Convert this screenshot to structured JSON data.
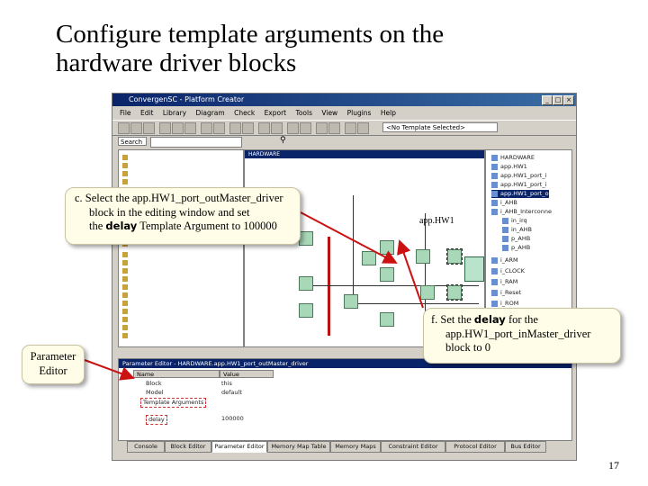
{
  "slide": {
    "title_line1": "Configure template arguments on the",
    "title_line2": "hardware driver blocks",
    "page_number": "17"
  },
  "app": {
    "title": "ConvergenSC - Platform Creator",
    "menu": [
      "File",
      "Edit",
      "Library",
      "Diagram",
      "Check",
      "Export",
      "Tools",
      "View",
      "Plugins",
      "Help"
    ],
    "template_combo": "<No Template Selected>",
    "search_label": "Search",
    "canvas_title": "HARDWARE",
    "right_tree": [
      {
        "label": "HARDWARE",
        "selected": false
      },
      {
        "label": "app.HW1",
        "selected": false
      },
      {
        "label": "app.HW1_port_i",
        "selected": false
      },
      {
        "label": "app.HW1_port_i",
        "selected": false
      },
      {
        "label": "app.HW1_port_o",
        "selected": true
      },
      {
        "label": "i_AHB",
        "selected": false
      },
      {
        "label": "i_AHB_Interconne",
        "selected": false
      },
      {
        "label": "in_irq",
        "selected": false
      },
      {
        "label": "in_AHB",
        "selected": false
      },
      {
        "label": "p_AHB",
        "selected": false
      },
      {
        "label": "p_AHB",
        "selected": false
      },
      {
        "label": "i_ARM",
        "selected": false
      },
      {
        "label": "i_CLOCK",
        "selected": false
      },
      {
        "label": "i_RAM",
        "selected": false
      },
      {
        "label": "i_Reset",
        "selected": false
      },
      {
        "label": "i_ROM",
        "selected": false
      }
    ],
    "parameter_editor": {
      "title": "Parameter Editor - HARDWARE.app.HW1_port_outMaster_driver",
      "columns": [
        "Name",
        "Value"
      ],
      "rows": [
        {
          "name": "Block",
          "value": "this"
        },
        {
          "name": "Model",
          "value": "default"
        },
        {
          "name": "Template Arguments",
          "value": ""
        },
        {
          "name": "delay",
          "value": "100000"
        }
      ]
    },
    "tabs": [
      "Console",
      "Block Editor",
      "Parameter Editor",
      "Memory Map Table",
      "Memory Maps",
      "Constraint Editor",
      "Protocol Editor",
      "Bus Editor"
    ],
    "active_tab": "Parameter Editor"
  },
  "callouts": {
    "c_line1": "c. Select the app.HW1_port_outMaster_driver",
    "c_line2": "block in the editing window and set",
    "c_line3_pre": "the ",
    "c_line3_bold": "delay",
    "c_line3_post": " Template Argument to 100000",
    "f_line1_pre": "f. Set the ",
    "f_line1_bold": "delay",
    "f_line1_post": " for the",
    "f_line2": "app.HW1_port_inMaster_driver",
    "f_line3": "block to 0",
    "param_line1": "Parameter",
    "param_line2": "Editor",
    "hw_label": "app.HW1"
  },
  "colors": {
    "arrow": "#cc1111",
    "titlebar": "#0a246a",
    "callout_fill": "#fffde7"
  }
}
